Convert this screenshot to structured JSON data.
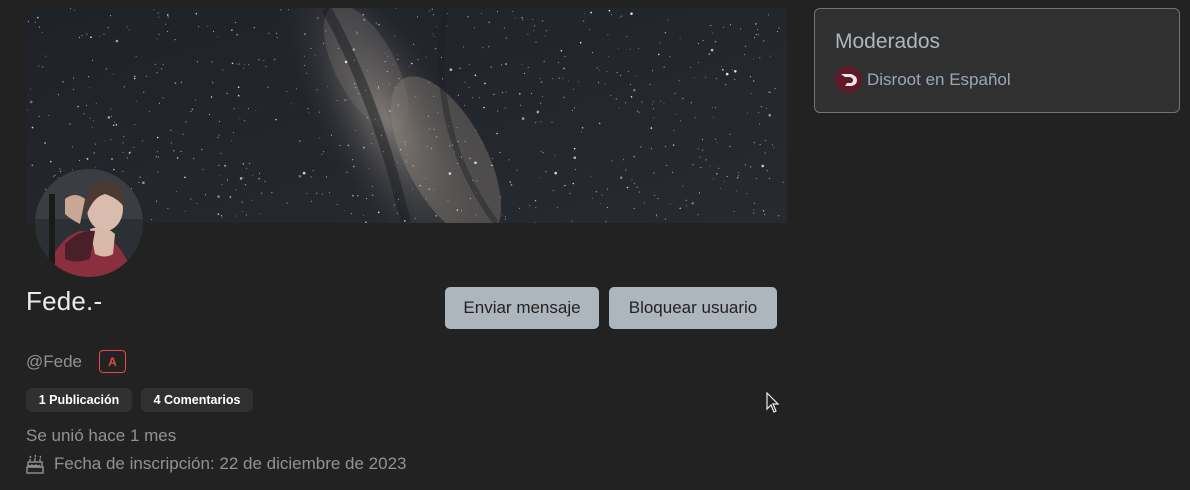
{
  "profile": {
    "display_name": "Fede.-",
    "handle": "@Fede",
    "admin_badge": "A",
    "posts_count": "1 Publicación",
    "comments_count": "4 Comentarios",
    "joined": "Se unió hace 1 mes",
    "cake_day": "Fecha de inscripción: 22 de diciembre de 2023"
  },
  "actions": {
    "send_message": "Enviar mensaje",
    "block_user": "Bloquear usuario"
  },
  "sidebar": {
    "moderated_title": "Moderados",
    "communities": [
      {
        "name": "Disroot en Español"
      }
    ]
  },
  "colors": {
    "background": "#222222",
    "button": "#adb5bd",
    "admin_badge": "#e74c3c",
    "link": "#9aa8b8"
  }
}
